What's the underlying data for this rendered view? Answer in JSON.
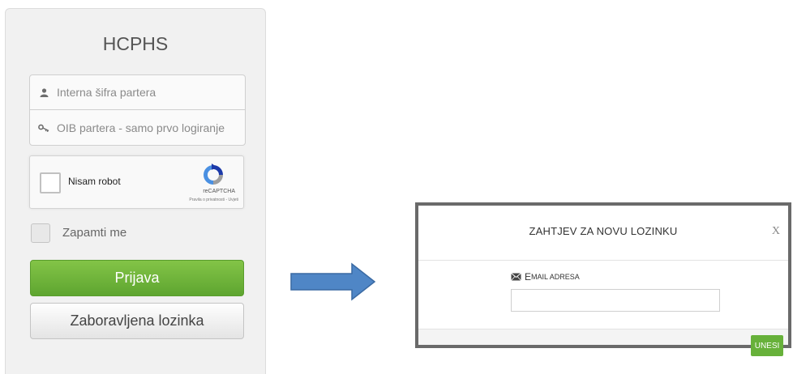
{
  "page": {
    "top_text": ""
  },
  "login": {
    "title": "HCPHS",
    "partner_code_placeholder": "Interna šifra partera",
    "oib_placeholder": "OIB partera - samo prvo logiranje",
    "captcha": {
      "label": "Nisam robot",
      "brand": "reCAPTCHA",
      "terms": "Pravila o privatnosti - Uvjeti"
    },
    "remember_label": "Zapamti me",
    "login_button": "Prijava",
    "forgot_button": "Zaboravljena lozinka"
  },
  "modal": {
    "title": "ZAHTJEV ZA NOVU LOZINKU",
    "close": "X",
    "email_label_first": "E",
    "email_label_rest": "MAIL ADRESA",
    "submit_button": "UNESI"
  },
  "colors": {
    "login_button": "#6cb33e",
    "submit_button": "#67b13a",
    "arrow": "#4f86c6"
  },
  "icons": [
    "user-icon",
    "key-icon",
    "recaptcha-icon",
    "arrow-right-icon",
    "envelope-icon"
  ]
}
